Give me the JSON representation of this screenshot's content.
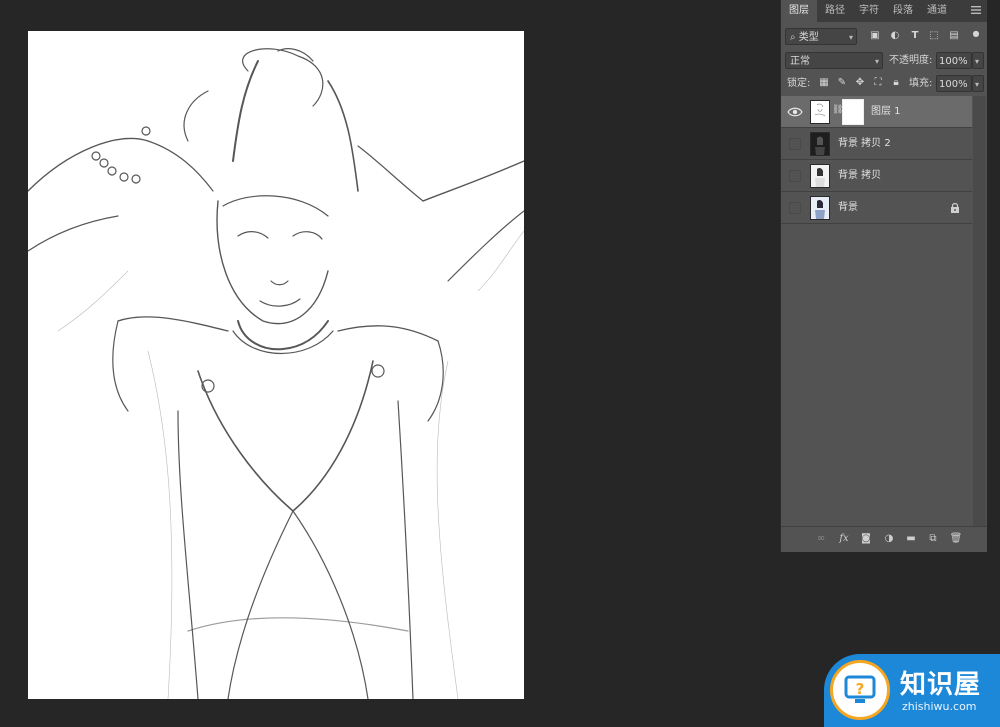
{
  "panel": {
    "tabs": [
      "图层",
      "路径",
      "字符",
      "段落",
      "通道"
    ],
    "active_tab": "图层",
    "filter": {
      "kind_label": "类型"
    },
    "blend_mode": "正常",
    "opacity_label": "不透明度:",
    "opacity_value": "100%",
    "lock_label": "锁定:",
    "fill_label": "填充:",
    "fill_value": "100%",
    "layers": [
      {
        "name": "图层 1",
        "selected": true,
        "visible": true
      },
      {
        "name": "背景 拷贝 2",
        "selected": false,
        "visible": false
      },
      {
        "name": "背景 拷贝",
        "selected": false,
        "visible": false
      },
      {
        "name": "背景",
        "selected": false,
        "visible": false,
        "locked": true
      }
    ],
    "bottom_icons": [
      "link-icon",
      "fx-icon",
      "mask-icon",
      "adjustment-icon",
      "folder-icon",
      "new-layer-icon",
      "trash-icon"
    ],
    "fx_label": "fx"
  },
  "watermark": {
    "title": "知识屋",
    "subtitle": "zhishiwu.com"
  },
  "colors": {
    "app_bg": "#262626",
    "panel_bg": "#535353",
    "selected_layer": "#6b6b6b",
    "watermark_blue": "#1e88d8"
  }
}
